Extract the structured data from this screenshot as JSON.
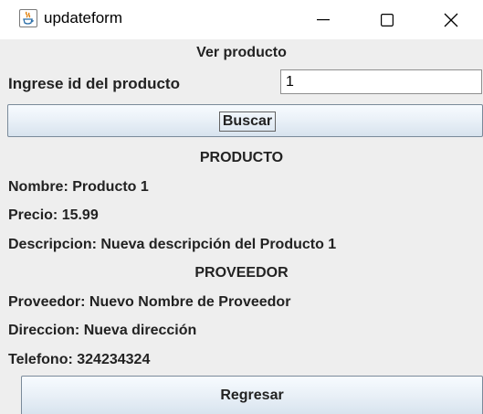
{
  "window": {
    "title": "updateform",
    "icons": {
      "app": "java-cup-icon",
      "minimize": "minimize-icon",
      "maximize": "maximize-icon",
      "close": "close-icon"
    }
  },
  "form": {
    "heading": "Ver producto",
    "id_label": "Ingrese id del producto",
    "id_value": "1",
    "search_button": "Buscar"
  },
  "product": {
    "section_title": "PRODUCTO",
    "name": "Nombre: Producto 1",
    "price": "Precio: 15.99",
    "description": "Descripcion: Nueva descripción del Producto 1"
  },
  "supplier": {
    "section_title": "PROVEEDOR",
    "name": "Proveedor: Nuevo Nombre de Proveedor",
    "address": "Direccion: Nueva dirección",
    "phone": "Telefono: 324234324"
  },
  "back_button": "Regresar"
}
